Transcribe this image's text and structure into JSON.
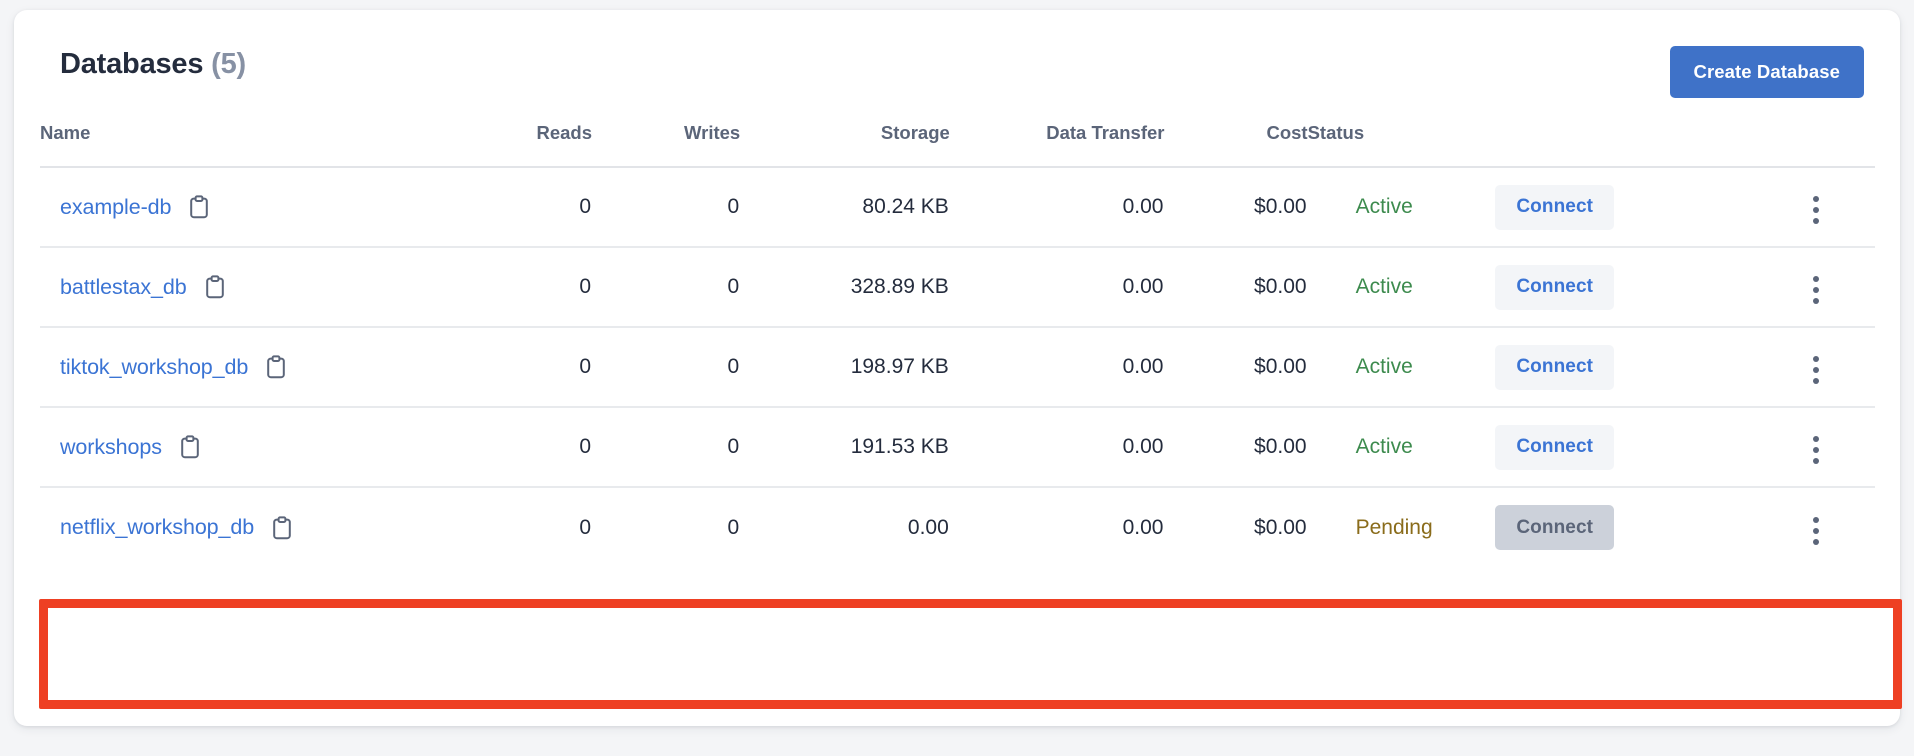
{
  "card": {
    "title": "Databases",
    "count": "(5)",
    "create_button": "Create Database"
  },
  "table": {
    "headers": {
      "name": "Name",
      "reads": "Reads",
      "writes": "Writes",
      "storage": "Storage",
      "data_transfer": "Data Transfer",
      "cost": "Cost",
      "status": "Status"
    },
    "row_action_label": "Connect",
    "copy_icon": "clipboard-icon",
    "menu_icon": "more-vertical-icon",
    "rows": [
      {
        "name": "example-db",
        "reads": "0",
        "writes": "0",
        "storage": "80.24 KB",
        "data_transfer": "0.00",
        "cost": "$0.00",
        "status": "Active",
        "status_state": "active",
        "connect": "Connect",
        "connect_enabled": true,
        "highlighted": false
      },
      {
        "name": "battlestax_db",
        "reads": "0",
        "writes": "0",
        "storage": "328.89 KB",
        "data_transfer": "0.00",
        "cost": "$0.00",
        "status": "Active",
        "status_state": "active",
        "connect": "Connect",
        "connect_enabled": true,
        "highlighted": false
      },
      {
        "name": "tiktok_workshop_db",
        "reads": "0",
        "writes": "0",
        "storage": "198.97 KB",
        "data_transfer": "0.00",
        "cost": "$0.00",
        "status": "Active",
        "status_state": "active",
        "connect": "Connect",
        "connect_enabled": true,
        "highlighted": false
      },
      {
        "name": "workshops",
        "reads": "0",
        "writes": "0",
        "storage": "191.53 KB",
        "data_transfer": "0.00",
        "cost": "$0.00",
        "status": "Active",
        "status_state": "active",
        "connect": "Connect",
        "connect_enabled": true,
        "highlighted": false
      },
      {
        "name": "netflix_workshop_db",
        "reads": "0",
        "writes": "0",
        "storage": "0.00",
        "data_transfer": "0.00",
        "cost": "$0.00",
        "status": "Pending",
        "status_state": "pending",
        "connect": "Connect",
        "connect_enabled": false,
        "highlighted": true
      }
    ]
  },
  "colors": {
    "accent_blue": "#3f72c8",
    "link_blue": "#3b74d4",
    "status_active": "#3d8b4e",
    "status_pending": "#8a6c1b",
    "highlight_red": "#ee4023",
    "header_text": "#5b6579",
    "body_text": "#242c3d"
  }
}
